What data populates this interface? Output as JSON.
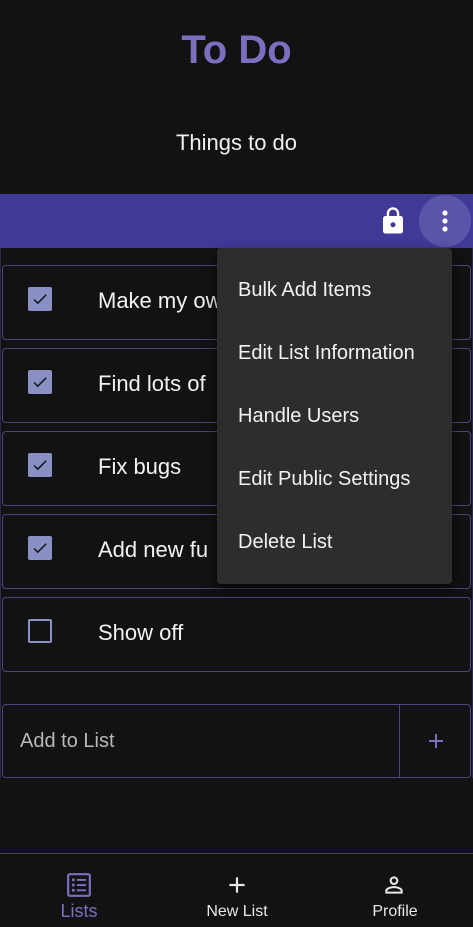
{
  "header": {
    "title": "To Do",
    "list_name": "Things to do"
  },
  "colors": {
    "accent": "#7b70c0",
    "toolbar": "#3f3a98",
    "checkbox": "#8a90c4",
    "menu_bg": "#2d2d2d"
  },
  "toolbar": {
    "icons": [
      "lock-icon",
      "more-vertical-icon"
    ]
  },
  "items": [
    {
      "text": "Make my own",
      "checked": true
    },
    {
      "text": "Find lots of",
      "checked": true
    },
    {
      "text": "Fix bugs",
      "checked": true
    },
    {
      "text": "Add new fu",
      "checked": true
    },
    {
      "text": "Show off",
      "checked": false
    }
  ],
  "add": {
    "placeholder": "Add to List"
  },
  "menu": {
    "items": [
      "Bulk Add Items",
      "Edit List Information",
      "Handle Users",
      "Edit Public Settings",
      "Delete List"
    ]
  },
  "nav": {
    "items": [
      {
        "label": "Lists",
        "icon": "list-icon",
        "active": true
      },
      {
        "label": "New List",
        "icon": "plus-icon",
        "active": false
      },
      {
        "label": "Profile",
        "icon": "person-icon",
        "active": false
      }
    ]
  }
}
